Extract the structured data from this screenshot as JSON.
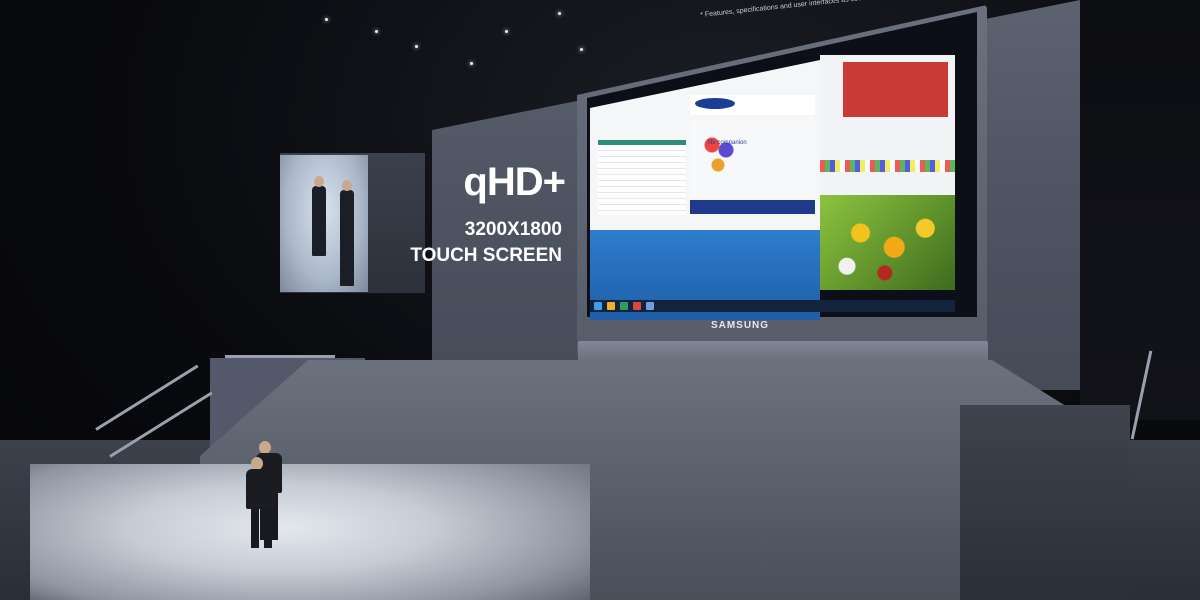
{
  "main_screen": {
    "spec_title": "qHD+",
    "spec_resolution": "3200X1800",
    "spec_feature": "TOUCH SCREEN",
    "small_print": "* Features, specifications and user interfaces as seen here may change without notice."
  },
  "laptop": {
    "brand": "SAMSUNG",
    "screen_heading": "life companion"
  },
  "colors": {
    "backdrop": "#565c69",
    "text": "#ffffff",
    "desktop_blue": "#2f7fd0",
    "paint_red": "#c83a33"
  },
  "icons": [
    "start-button-icon",
    "taskbar-app-icon",
    "balloon-image",
    "flowers-photo"
  ]
}
